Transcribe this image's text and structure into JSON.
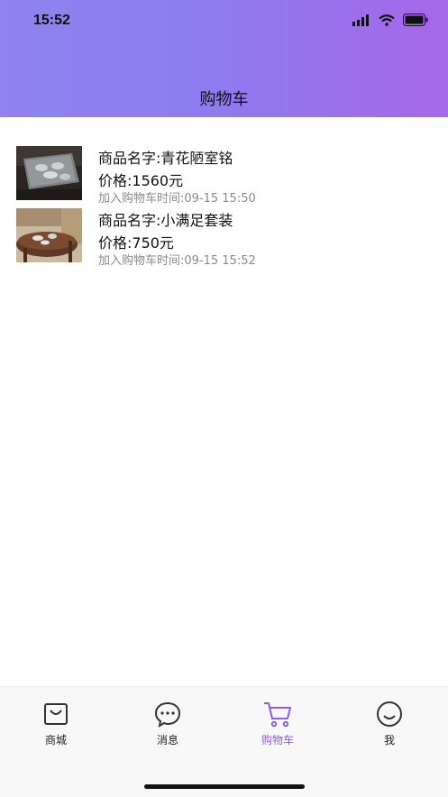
{
  "status_bar": {
    "time": "15:52"
  },
  "header": {
    "title": "购物车"
  },
  "cart_items": [
    {
      "name": "商品名字:青花陋室铭",
      "price": "价格:1560元",
      "added_time": "加入购物车时间:09-15 15:50"
    },
    {
      "name": "商品名字:小满足套装",
      "price": "价格:750元",
      "added_time": "加入购物车时间:09-15 15:52"
    }
  ],
  "tabbar": {
    "items": [
      {
        "label": "商城",
        "icon": "shopping-bag-icon"
      },
      {
        "label": "消息",
        "icon": "chat-bubble-icon"
      },
      {
        "label": "购物车",
        "icon": "cart-icon"
      },
      {
        "label": "我",
        "icon": "smiley-icon"
      }
    ],
    "active_index": 2
  },
  "colors": {
    "accent": "#8a5fe0",
    "header_start": "#8f83f0",
    "header_end": "#a667ea"
  }
}
